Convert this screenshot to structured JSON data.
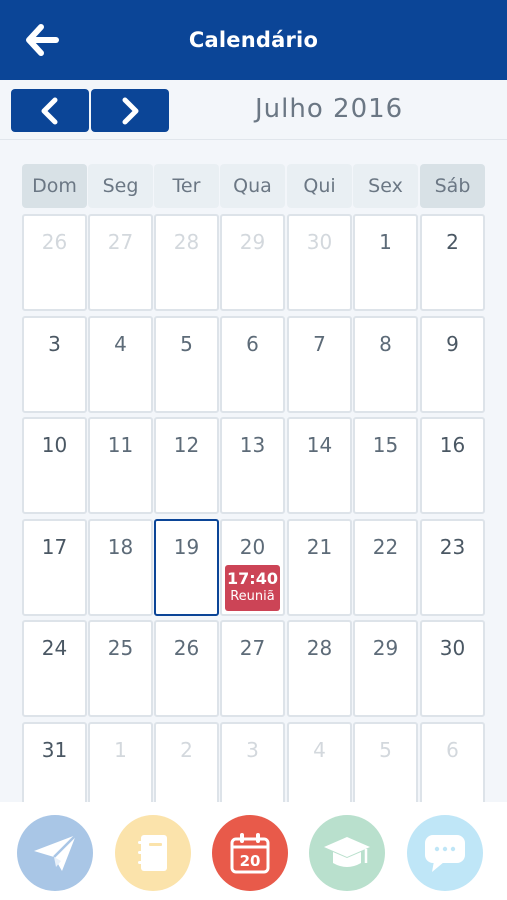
{
  "header": {
    "title": "Calendário",
    "back_icon": "arrow-left-icon"
  },
  "calendar": {
    "month_label": "Julho 2016",
    "prev_icon": "chevron-left-icon",
    "next_icon": "chevron-right-icon",
    "weekdays": [
      "Dom",
      "Seg",
      "Ter",
      "Qua",
      "Qui",
      "Sex",
      "Sáb"
    ],
    "selected_day": 19,
    "weeks": [
      [
        {
          "n": "26",
          "other": true
        },
        {
          "n": "27",
          "other": true
        },
        {
          "n": "28",
          "other": true
        },
        {
          "n": "29",
          "other": true
        },
        {
          "n": "30",
          "other": true
        },
        {
          "n": "1"
        },
        {
          "n": "2"
        }
      ],
      [
        {
          "n": "3"
        },
        {
          "n": "4"
        },
        {
          "n": "5"
        },
        {
          "n": "6"
        },
        {
          "n": "7"
        },
        {
          "n": "8"
        },
        {
          "n": "9"
        }
      ],
      [
        {
          "n": "10"
        },
        {
          "n": "11"
        },
        {
          "n": "12"
        },
        {
          "n": "13"
        },
        {
          "n": "14"
        },
        {
          "n": "15"
        },
        {
          "n": "16"
        }
      ],
      [
        {
          "n": "17"
        },
        {
          "n": "18"
        },
        {
          "n": "19",
          "selected": true
        },
        {
          "n": "20",
          "event": {
            "time": "17:40",
            "title": "Reuniã"
          }
        },
        {
          "n": "21"
        },
        {
          "n": "22"
        },
        {
          "n": "23"
        }
      ],
      [
        {
          "n": "24"
        },
        {
          "n": "25"
        },
        {
          "n": "26"
        },
        {
          "n": "27"
        },
        {
          "n": "28"
        },
        {
          "n": "29"
        },
        {
          "n": "30"
        }
      ],
      [
        {
          "n": "31"
        },
        {
          "n": "1",
          "other": true
        },
        {
          "n": "2",
          "other": true
        },
        {
          "n": "3",
          "other": true
        },
        {
          "n": "4",
          "other": true
        },
        {
          "n": "5",
          "other": true
        },
        {
          "n": "6",
          "other": true
        }
      ]
    ]
  },
  "bottom_nav": {
    "items": [
      {
        "icon": "paper-plane-icon",
        "color": "#a9c6e6"
      },
      {
        "icon": "notebook-icon",
        "color": "#fbe3ab"
      },
      {
        "icon": "calendar-icon",
        "color": "#e85a4a",
        "badge": "20",
        "active": true
      },
      {
        "icon": "graduation-cap-icon",
        "color": "#b9e0cd"
      },
      {
        "icon": "chat-bubble-icon",
        "color": "#bfe6f7"
      }
    ]
  },
  "colors": {
    "primary": "#0b4597",
    "event": "#cc4456",
    "background": "#f3f6fa"
  }
}
